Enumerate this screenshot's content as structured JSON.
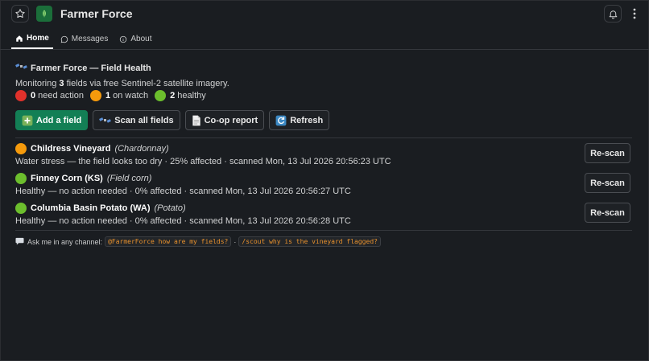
{
  "app": {
    "title": "Farmer Force"
  },
  "tabs": [
    {
      "label": "Home",
      "icon": "home-icon",
      "active": true
    },
    {
      "label": "Messages",
      "icon": "chat-bubble-icon",
      "active": false
    },
    {
      "label": "About",
      "icon": "info-icon",
      "active": false
    }
  ],
  "main": {
    "title": "Farmer Force — Field Health",
    "monitoring_prefix": "Monitoring ",
    "monitoring_count": "3",
    "monitoring_suffix": " fields via free Sentinel-2 satellite imagery.",
    "status": [
      {
        "count": "0",
        "label": "need action",
        "color": "#e0312b"
      },
      {
        "count": "1",
        "label": "on watch",
        "color": "#f59a0c"
      },
      {
        "count": "2",
        "label": "healthy",
        "color": "#6cbe2d"
      }
    ],
    "actions": [
      {
        "label": "Add a field",
        "icon": "plus-icon"
      },
      {
        "label": "Scan all fields",
        "icon": "satellite-icon"
      },
      {
        "label": "Co-op report",
        "icon": "document-icon"
      },
      {
        "label": "Refresh",
        "icon": "refresh-icon"
      }
    ]
  },
  "fields": [
    {
      "name": "Childress Vineyard",
      "crop": "(Chardonnay)",
      "status_color": "#f59a0c",
      "status": "Water stress — the field looks too dry · 25% affected · scanned Mon, 13 Jul 2026 20:56:23 UTC",
      "button": "Re-scan"
    },
    {
      "name": "Finney Corn (KS)",
      "crop": "(Field corn)",
      "status_color": "#6cbe2d",
      "status": "Healthy — no action needed · 0% affected · scanned Mon, 13 Jul 2026 20:56:27 UTC",
      "button": "Re-scan"
    },
    {
      "name": "Columbia Basin Potato (WA)",
      "crop": "(Potato)",
      "status_color": "#6cbe2d",
      "status": "Healthy — no action needed · 0% affected · scanned Mon, 13 Jul 2026 20:56:28 UTC",
      "button": "Re-scan"
    }
  ],
  "hint": {
    "text": "Ask me in any channel:",
    "example1": "@FarmerForce how are my fields?",
    "separator": "·",
    "example2": "/scout why is the vineyard flagged?"
  }
}
